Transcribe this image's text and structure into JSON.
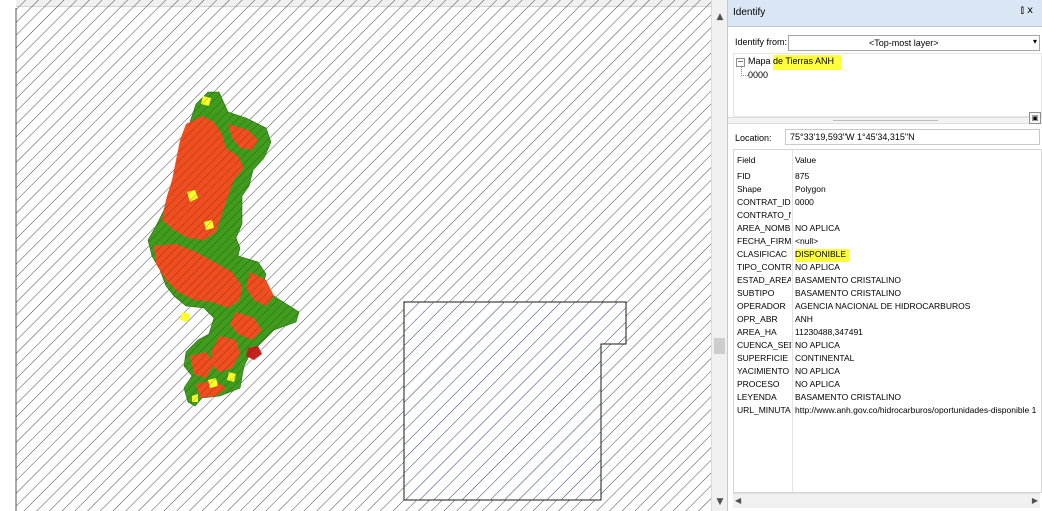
{
  "identify": {
    "title": "Identify",
    "pin_glyph": "⫾ x",
    "from_label": "Identify from:",
    "from_value": "<Top-most layer>",
    "tree": {
      "layer_prefix": "Mapa ",
      "layer_highlight": "de Tierras ANH",
      "child": "0000"
    },
    "location_label": "Location:",
    "location_value": "75°33'19,593\"W  1°45'34,315\"N",
    "grid": {
      "header": {
        "field": "Field",
        "value": "Value"
      },
      "rows": [
        {
          "field": "FID",
          "value": "875"
        },
        {
          "field": "Shape",
          "value": "Polygon"
        },
        {
          "field": "CONTRAT_ID",
          "value": "0000"
        },
        {
          "field": "CONTRATO_N",
          "value": ""
        },
        {
          "field": "AREA_NOMBR",
          "value": "NO APLICA"
        },
        {
          "field": "FECHA_FIRM",
          "value": "<null>"
        },
        {
          "field": "CLASIFICAC",
          "value": "DISPONIBLE",
          "highlight": true
        },
        {
          "field": "TIPO_CONTR",
          "value": "NO APLICA"
        },
        {
          "field": "ESTAD_AREA",
          "value": "BASAMENTO CRISTALINO"
        },
        {
          "field": "SUBTIPO",
          "value": "BASAMENTO CRISTALINO"
        },
        {
          "field": "OPERADOR",
          "value": "AGENCIA NACIONAL DE HIDROCARBUROS"
        },
        {
          "field": "OPR_ABR",
          "value": "ANH"
        },
        {
          "field": "AREA_HA",
          "value": "11230488,347491"
        },
        {
          "field": "CUENCA_SED",
          "value": "NO APLICA"
        },
        {
          "field": "SUPERFICIE",
          "value": "CONTINENTAL"
        },
        {
          "field": "YACIMIENTO",
          "value": "NO APLICA"
        },
        {
          "field": "PROCESO",
          "value": "NO APLICA"
        },
        {
          "field": "LEYENDA",
          "value": "BASAMENTO CRISTALINO"
        },
        {
          "field": "URL_MINUTA",
          "value": "http://www.anh.gov.co/hidrocarburos/oportunidades-disponible 1"
        }
      ]
    }
  },
  "map": {
    "hatch_color": "#4a4a4a",
    "block_hatch_color": "#2e3f6e",
    "region_colors": {
      "orange": "#f04e1e",
      "green": "#3f9c1c",
      "yellow": "#ffff2a",
      "red": "#c8201c"
    }
  },
  "highlight_color": "#ffff3c"
}
